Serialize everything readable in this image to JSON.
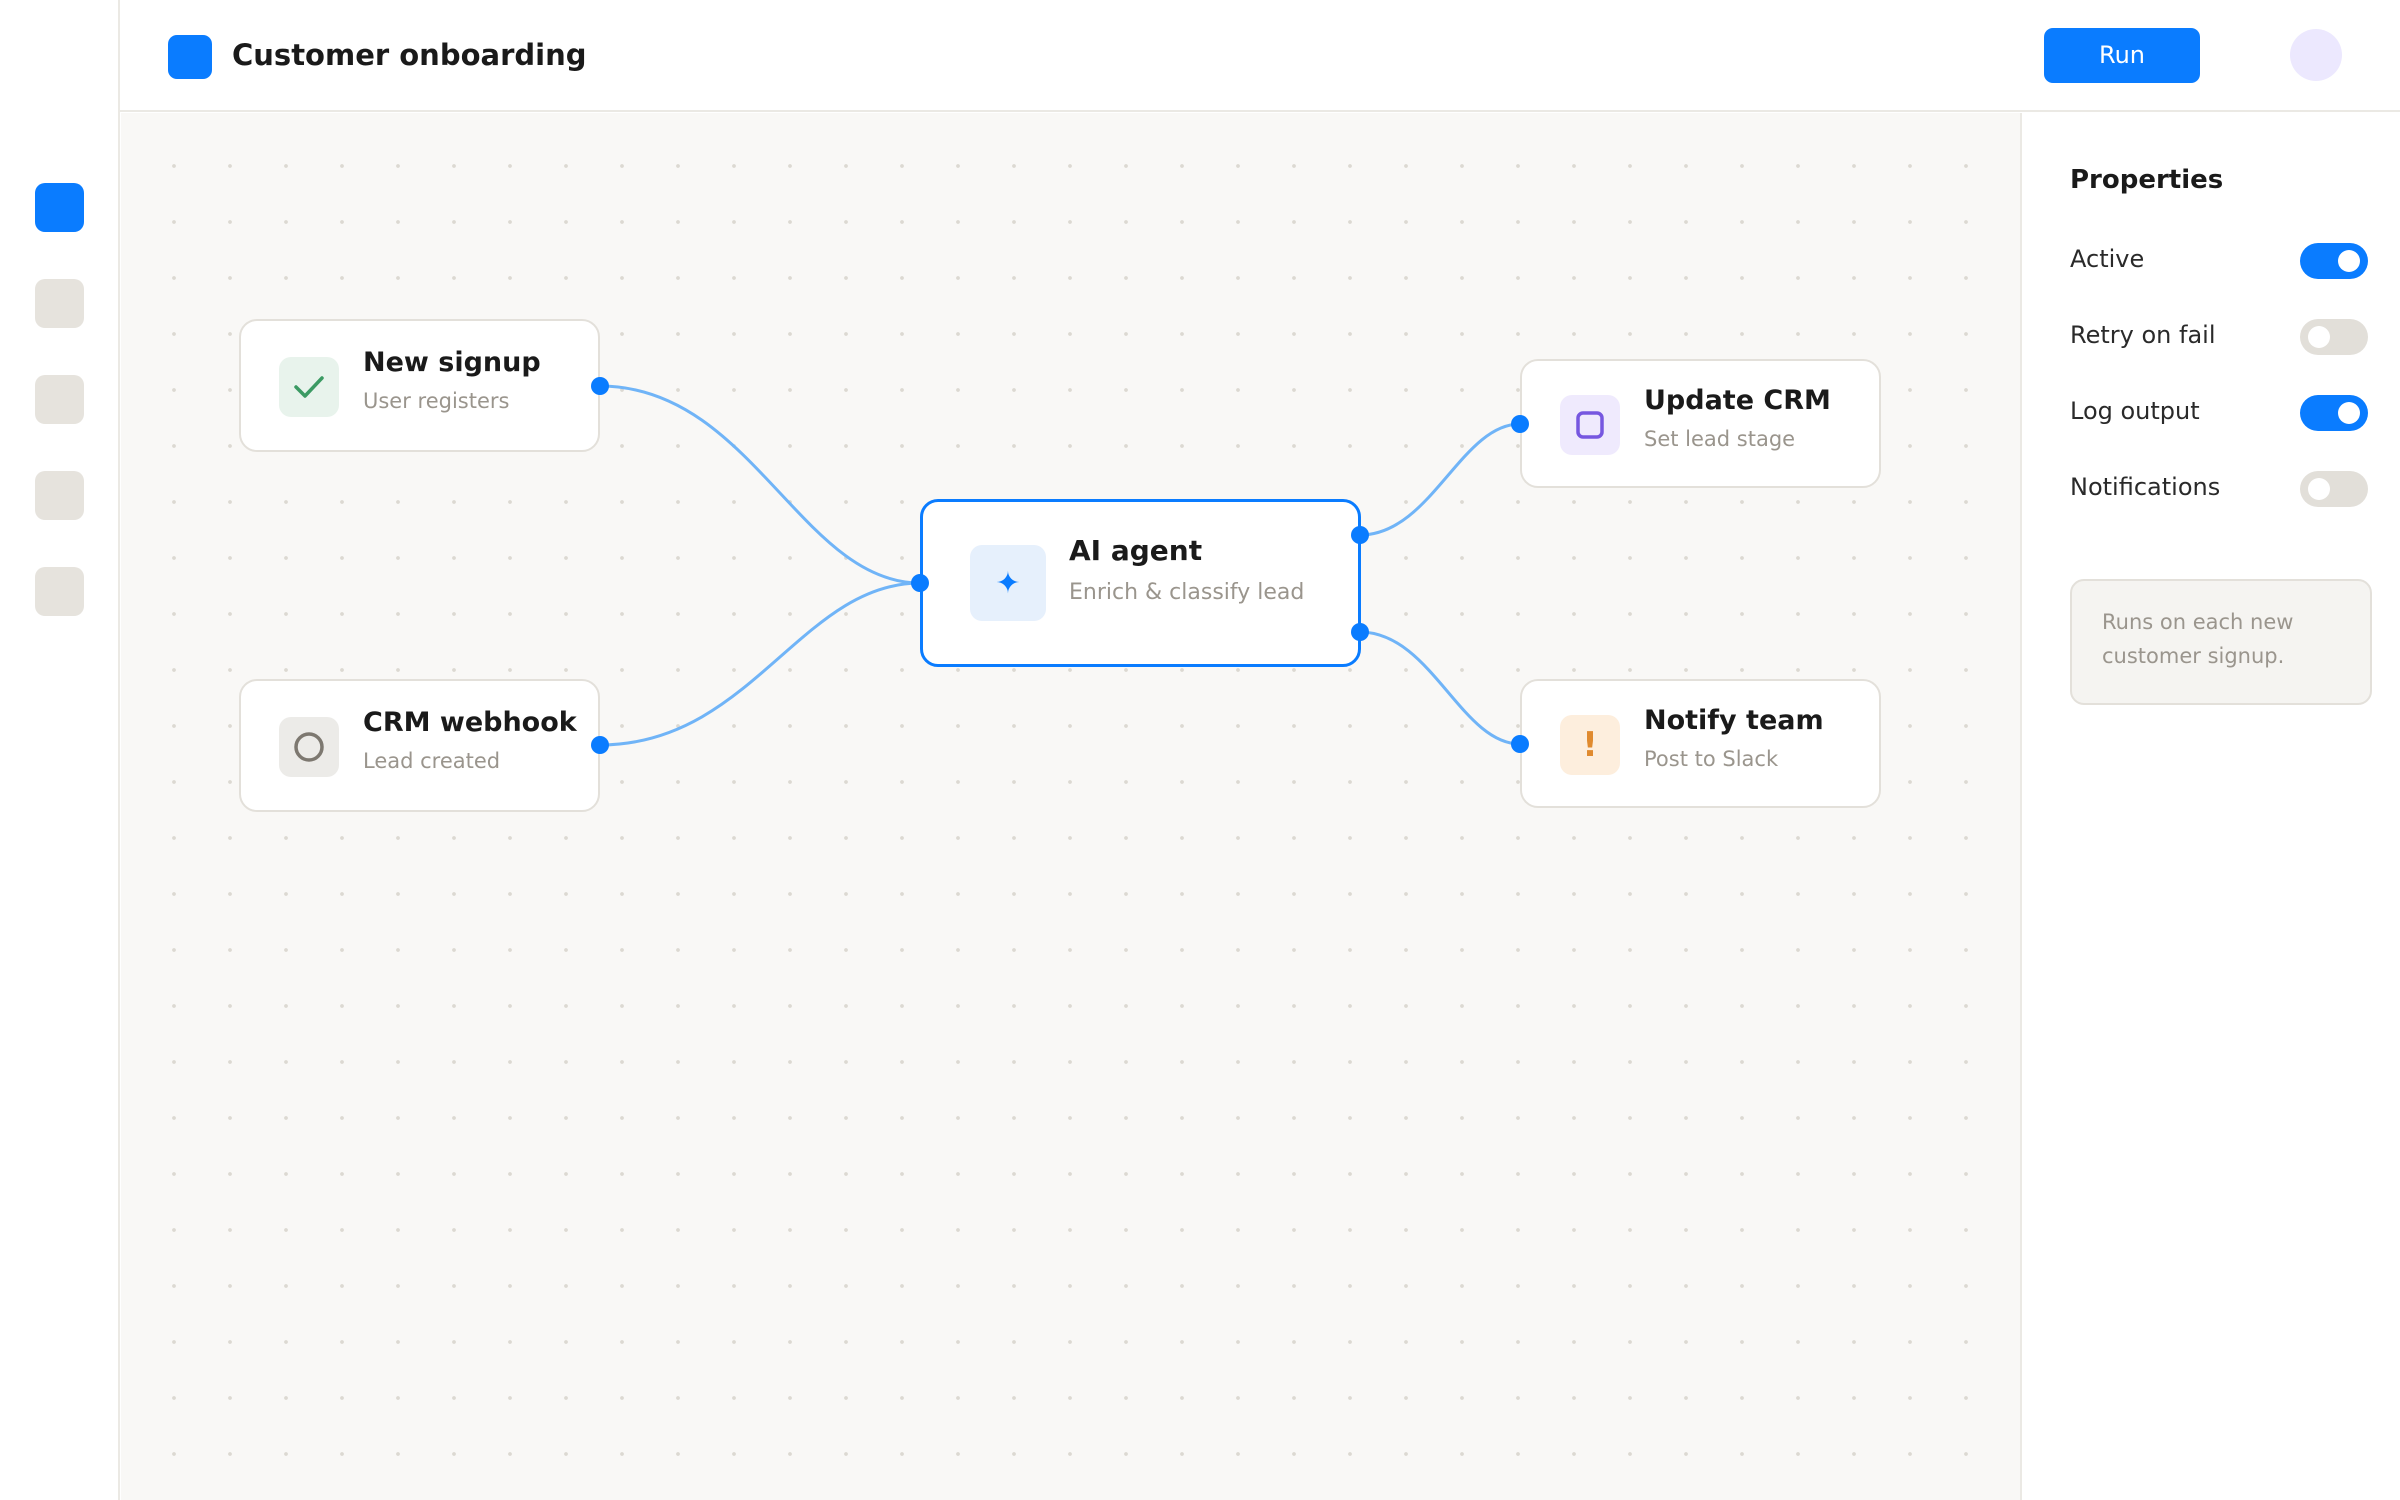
{
  "app": {
    "title": "Customer onboarding",
    "run_label": "Run",
    "accent_color": "#0a7cff"
  },
  "sidebar": {
    "items": [
      {
        "name": "rail-item-1",
        "active": true
      },
      {
        "name": "rail-item-2",
        "active": false
      },
      {
        "name": "rail-item-3",
        "active": false
      },
      {
        "name": "rail-item-4",
        "active": false
      },
      {
        "name": "rail-item-5",
        "active": false
      }
    ]
  },
  "nodes": {
    "new_signup": {
      "title": "New signup",
      "subtitle": "User registers",
      "icon": "check-icon",
      "icon_color": "#3b9a63"
    },
    "crm_webhook": {
      "title": "CRM webhook",
      "subtitle": "Lead created",
      "icon": "circle-icon",
      "icon_color": "#7d7870"
    },
    "ai_agent": {
      "title": "AI agent",
      "subtitle": "Enrich & classify lead",
      "icon": "sparkle-icon",
      "icon_color": "#0a7cff",
      "icon_glyph": "✦",
      "selected": true
    },
    "update_crm": {
      "title": "Update CRM",
      "subtitle": "Set lead stage",
      "icon": "square-icon",
      "icon_color": "#7657e0"
    },
    "notify_team": {
      "title": "Notify team",
      "subtitle": "Post to Slack",
      "icon": "exclamation-icon",
      "icon_color": "#e08a2e",
      "icon_glyph": "!"
    }
  },
  "edges": [
    {
      "from": "new_signup",
      "to": "ai_agent"
    },
    {
      "from": "crm_webhook",
      "to": "ai_agent"
    },
    {
      "from": "ai_agent",
      "to": "update_crm"
    },
    {
      "from": "ai_agent",
      "to": "notify_team"
    }
  ],
  "properties": {
    "title": "Properties",
    "items": [
      {
        "label": "Active",
        "on": true
      },
      {
        "label": "Retry on fail",
        "on": false
      },
      {
        "label": "Log output",
        "on": true
      },
      {
        "label": "Notifications",
        "on": false
      }
    ],
    "note": "Runs on each new customer signup."
  }
}
